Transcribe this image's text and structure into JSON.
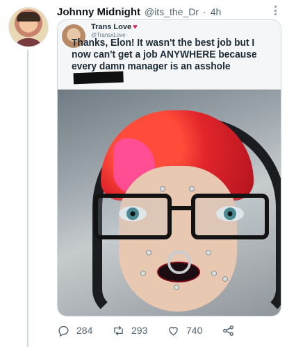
{
  "tweet": {
    "author_name": "Johnny Midnight",
    "handle": "@its_the_Dr",
    "separator": "·",
    "time": "4h",
    "actions": {
      "replies": "284",
      "retweets": "293",
      "likes": "740"
    }
  },
  "quoted_post": {
    "author_name": "Trans Love",
    "handle": "@TransxLove",
    "text": "Thanks, Elon! It wasn't the best job but I now can't get a job ANYWHERE because every damn manager is an asshole"
  },
  "icons": [
    "reply-icon",
    "retweet-icon",
    "like-icon",
    "share-icon",
    "more-icon"
  ],
  "colors": {
    "text": "#0f1419",
    "secondary": "#536471",
    "heart": "#e0245e"
  }
}
